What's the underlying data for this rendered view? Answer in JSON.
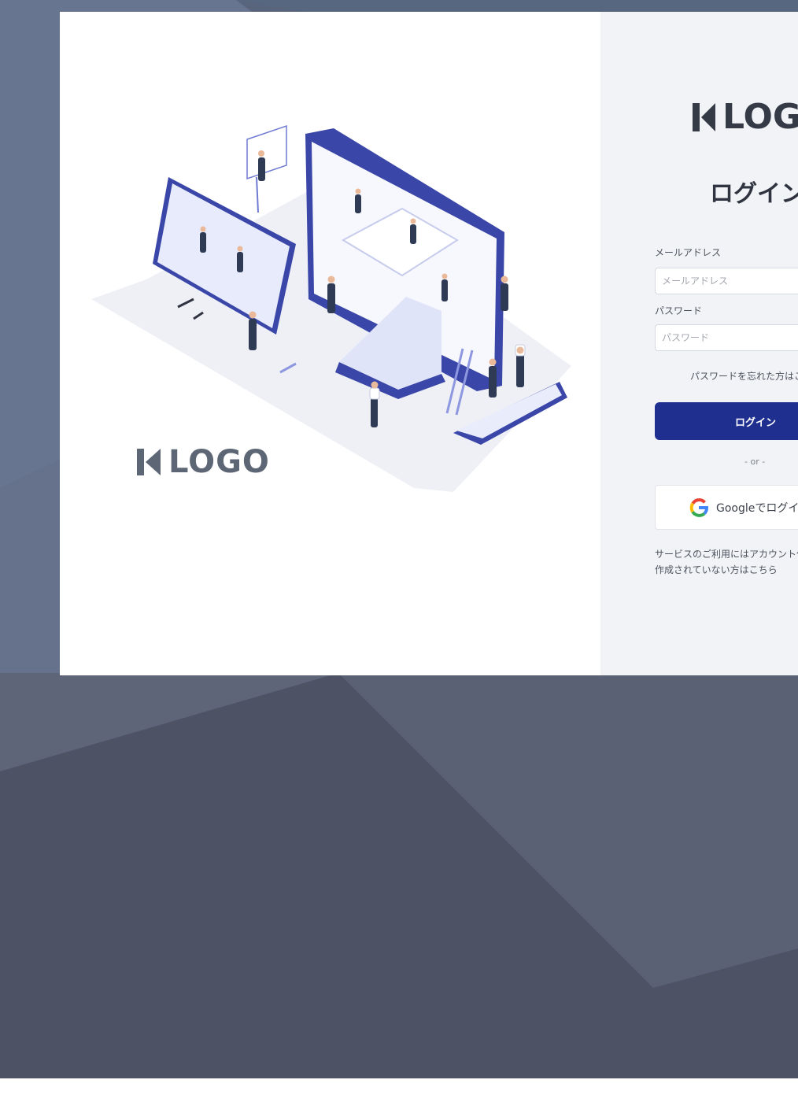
{
  "colors": {
    "brand_primary": "#1f2f8f",
    "illustration_blue": "#3a46a8",
    "panel_background": "#f2f3f6",
    "backdrop_dark": "#4e5366",
    "logo_gray": "#5d6675"
  },
  "brand": {
    "logo_text": "LOGO",
    "logo_text_visible": "LOGO"
  },
  "login_form": {
    "title": "ログイン",
    "email_label": "メールアドレス",
    "email_placeholder": "メールアドレス",
    "email_value": "",
    "password_label": "パスワード",
    "password_placeholder": "パスワード",
    "password_value": "",
    "forgot_password": "パスワードを忘れた方はこ",
    "login_button": "ログイン",
    "divider": "- or -",
    "google_button": "Googleでログイン",
    "account_note_line1": "サービスのご利用にはアカウント作",
    "account_note_line2": "作成されていない方はこちら"
  },
  "icons": {
    "logo_mark": "k-logo-mark-icon",
    "google": "google-g-icon"
  }
}
